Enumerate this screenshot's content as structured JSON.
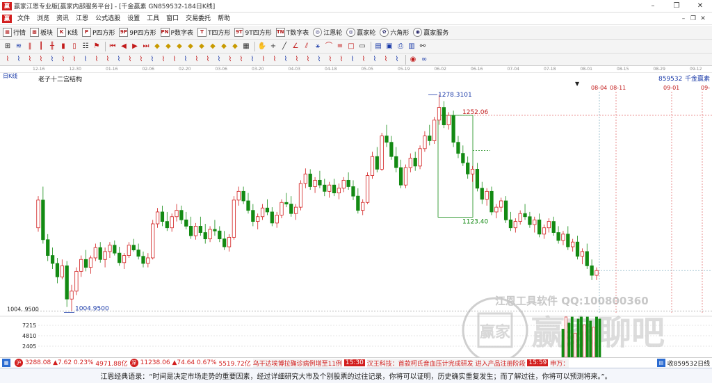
{
  "window": {
    "title": "赢家江恩专业版[赢家内部服务平台] - [千金赢素  GN859532-184日K线]",
    "logo_text": "赢",
    "minimize": "–",
    "maximize": "❐",
    "close": "✕"
  },
  "menu": {
    "items": [
      "文件",
      "浏览",
      "资讯",
      "江恩",
      "公式选股",
      "设置",
      "工具",
      "窗口",
      "交易委托",
      "帮助"
    ],
    "mdi_minimize": "–",
    "mdi_restore": "❐",
    "mdi_close": "✕"
  },
  "toolbar1": {
    "items": [
      {
        "icon": "▦",
        "label": "行情"
      },
      {
        "icon": "▩",
        "label": "板块"
      },
      {
        "icon": "K",
        "label": "K线"
      },
      {
        "icon": "P",
        "label": "P四方形"
      },
      {
        "icon": "9P",
        "label": "9P四方形"
      },
      {
        "icon": "PN",
        "label": "P数字表"
      },
      {
        "icon": "T",
        "label": "T四方形"
      },
      {
        "icon": "9T",
        "label": "9T四方形"
      },
      {
        "icon": "TN",
        "label": "T数字表"
      },
      {
        "icon": "◎",
        "label": "江恩轮"
      },
      {
        "icon": "◎",
        "label": "赢家轮"
      },
      {
        "icon": "✿",
        "label": "六角形"
      },
      {
        "icon": "◉",
        "label": "赢家服务"
      }
    ]
  },
  "chart_header": {
    "period": "日K线",
    "study_name": "老子十二宫结构",
    "code": "859532",
    "name": "千金赢素"
  },
  "datebar": {
    "labels": [
      "12-16",
      "12-30",
      "01-16",
      "02-06",
      "02-20",
      "03-06",
      "03-20",
      "04-03",
      "04-18",
      "05-05",
      "05-19",
      "06-02",
      "06-16",
      "07-04",
      "07-18",
      "08-01",
      "08-15",
      "08-29",
      "09-12"
    ]
  },
  "annotations": {
    "high": "1278.3101",
    "box_top": "1252.06",
    "box_bottom": "1123.40",
    "low": "1004.9500",
    "axis_low": "1004. 9500",
    "date_0804": "08-04",
    "date_0811": "08-11",
    "date_0901": "09-01",
    "date_09": "09-"
  },
  "volume_axis": {
    "ticks": [
      "7215",
      "4810",
      "2405"
    ]
  },
  "watermark": {
    "line1": "江恩工具软件  QQ:100800360",
    "brand": "赢家聊吧",
    "seal": "赢家"
  },
  "statusbar": {
    "index1_value": "3288.08",
    "index1_change": "▲7.62",
    "index1_pct": "0.23%",
    "index1_amount": "4971.88亿",
    "index2_value": "11238.06",
    "index2_change": "▲74.64",
    "index2_pct": "0.67%",
    "index2_amount": "5519.72亿",
    "news1": "乌干达埃博拉确诊病例增至11例",
    "news1_time": "15:30",
    "news2": "汉王科技：首款柯氏音血压计完成研发 进入产品注册阶段",
    "news2_time": "15:59",
    "news3": "申万：",
    "right_text": "收859532日线"
  },
  "quote": {
    "text": "江恩经典语录：“时间是决定市场走势的重要因素，经过详细研究大市及个别股票的过往记录，你将可以证明，历史确实重复发生；而了解过往，你将可以预测将来。”。"
  },
  "colors": {
    "up": "#d21e1e",
    "down": "#138a13",
    "accent_blue": "#1a3aa8"
  },
  "chart_data": {
    "type": "candlestick",
    "title": "老子十二宫结构",
    "ohlc": [
      [
        1110,
        1150,
        1105,
        1145
      ],
      [
        1145,
        1162,
        1090,
        1095
      ],
      [
        1095,
        1102,
        1068,
        1075
      ],
      [
        1075,
        1085,
        1058,
        1065
      ],
      [
        1065,
        1072,
        1040,
        1048
      ],
      [
        1048,
        1070,
        1045,
        1062
      ],
      [
        1062,
        1068,
        1010,
        1020
      ],
      [
        1020,
        1038,
        1005,
        1030
      ],
      [
        1030,
        1060,
        1025,
        1055
      ],
      [
        1055,
        1075,
        1048,
        1070
      ],
      [
        1070,
        1082,
        1055,
        1060
      ],
      [
        1060,
        1075,
        1052,
        1072
      ],
      [
        1072,
        1090,
        1068,
        1085
      ],
      [
        1085,
        1092,
        1066,
        1070
      ],
      [
        1070,
        1085,
        1060,
        1080
      ],
      [
        1080,
        1092,
        1072,
        1088
      ],
      [
        1088,
        1094,
        1075,
        1078
      ],
      [
        1078,
        1086,
        1062,
        1066
      ],
      [
        1066,
        1078,
        1058,
        1075
      ],
      [
        1075,
        1092,
        1072,
        1088
      ],
      [
        1088,
        1096,
        1080,
        1082
      ],
      [
        1082,
        1090,
        1070,
        1074
      ],
      [
        1074,
        1080,
        1060,
        1065
      ],
      [
        1065,
        1078,
        1060,
        1072
      ],
      [
        1072,
        1120,
        1070,
        1115
      ],
      [
        1115,
        1135,
        1110,
        1130
      ],
      [
        1130,
        1138,
        1112,
        1118
      ],
      [
        1118,
        1130,
        1106,
        1110
      ],
      [
        1110,
        1128,
        1105,
        1124
      ],
      [
        1124,
        1140,
        1118,
        1132
      ],
      [
        1132,
        1138,
        1115,
        1120
      ],
      [
        1120,
        1130,
        1108,
        1112
      ],
      [
        1112,
        1124,
        1096,
        1100
      ],
      [
        1100,
        1116,
        1095,
        1112
      ],
      [
        1112,
        1124,
        1100,
        1104
      ],
      [
        1104,
        1115,
        1090,
        1096
      ],
      [
        1096,
        1112,
        1092,
        1108
      ],
      [
        1108,
        1120,
        1100,
        1106
      ],
      [
        1106,
        1112,
        1092,
        1096
      ],
      [
        1096,
        1106,
        1082,
        1086
      ],
      [
        1086,
        1102,
        1080,
        1098
      ],
      [
        1098,
        1150,
        1095,
        1145
      ],
      [
        1145,
        1162,
        1138,
        1156
      ],
      [
        1156,
        1162,
        1140,
        1144
      ],
      [
        1144,
        1154,
        1128,
        1132
      ],
      [
        1132,
        1140,
        1112,
        1118
      ],
      [
        1118,
        1128,
        1108,
        1124
      ],
      [
        1124,
        1140,
        1120,
        1135
      ],
      [
        1135,
        1146,
        1126,
        1130
      ],
      [
        1130,
        1136,
        1112,
        1116
      ],
      [
        1116,
        1130,
        1110,
        1126
      ],
      [
        1126,
        1146,
        1122,
        1142
      ],
      [
        1142,
        1154,
        1136,
        1140
      ],
      [
        1140,
        1150,
        1124,
        1128
      ],
      [
        1128,
        1140,
        1120,
        1136
      ],
      [
        1136,
        1170,
        1132,
        1166
      ],
      [
        1166,
        1185,
        1160,
        1178
      ],
      [
        1178,
        1184,
        1158,
        1162
      ],
      [
        1162,
        1174,
        1154,
        1170
      ],
      [
        1170,
        1182,
        1160,
        1164
      ],
      [
        1164,
        1172,
        1150,
        1156
      ],
      [
        1156,
        1168,
        1148,
        1164
      ],
      [
        1164,
        1172,
        1150,
        1154
      ],
      [
        1154,
        1166,
        1146,
        1160
      ],
      [
        1160,
        1174,
        1155,
        1170
      ],
      [
        1170,
        1180,
        1158,
        1162
      ],
      [
        1162,
        1170,
        1145,
        1150
      ],
      [
        1150,
        1160,
        1128,
        1132
      ],
      [
        1132,
        1146,
        1126,
        1142
      ],
      [
        1142,
        1180,
        1140,
        1176
      ],
      [
        1176,
        1206,
        1172,
        1200
      ],
      [
        1200,
        1212,
        1180,
        1184
      ],
      [
        1184,
        1230,
        1182,
        1226
      ],
      [
        1226,
        1240,
        1212,
        1218
      ],
      [
        1218,
        1226,
        1196,
        1200
      ],
      [
        1200,
        1212,
        1180,
        1186
      ],
      [
        1186,
        1196,
        1160,
        1164
      ],
      [
        1164,
        1190,
        1160,
        1186
      ],
      [
        1186,
        1204,
        1180,
        1198
      ],
      [
        1198,
        1206,
        1182,
        1188
      ],
      [
        1188,
        1214,
        1184,
        1210
      ],
      [
        1210,
        1232,
        1206,
        1226
      ],
      [
        1226,
        1240,
        1214,
        1220
      ],
      [
        1220,
        1250,
        1216,
        1246
      ],
      [
        1246,
        1278,
        1240,
        1262
      ],
      [
        1262,
        1270,
        1236,
        1240
      ],
      [
        1240,
        1256,
        1234,
        1252
      ],
      [
        1252,
        1258,
        1212,
        1218
      ],
      [
        1218,
        1226,
        1198,
        1204
      ],
      [
        1204,
        1214,
        1188,
        1192
      ],
      [
        1192,
        1200,
        1172,
        1178
      ],
      [
        1178,
        1188,
        1168,
        1184
      ],
      [
        1184,
        1192,
        1156,
        1160
      ],
      [
        1160,
        1168,
        1140,
        1146
      ],
      [
        1146,
        1160,
        1138,
        1156
      ],
      [
        1156,
        1162,
        1126,
        1130
      ],
      [
        1130,
        1140,
        1122,
        1136
      ],
      [
        1136,
        1148,
        1130,
        1144
      ],
      [
        1144,
        1150,
        1116,
        1120
      ],
      [
        1120,
        1130,
        1106,
        1110
      ],
      [
        1110,
        1122,
        1104,
        1118
      ],
      [
        1118,
        1132,
        1114,
        1128
      ],
      [
        1128,
        1140,
        1120,
        1124
      ],
      [
        1124,
        1130,
        1110,
        1114
      ],
      [
        1114,
        1124,
        1104,
        1120
      ],
      [
        1120,
        1128,
        1098,
        1102
      ],
      [
        1102,
        1114,
        1096,
        1110
      ],
      [
        1110,
        1122,
        1104,
        1118
      ],
      [
        1118,
        1124,
        1100,
        1104
      ],
      [
        1104,
        1112,
        1090,
        1094
      ],
      [
        1094,
        1106,
        1088,
        1102
      ],
      [
        1102,
        1112,
        1082,
        1086
      ],
      [
        1086,
        1096,
        1080,
        1092
      ],
      [
        1092,
        1100,
        1070,
        1074
      ],
      [
        1074,
        1084,
        1064,
        1080
      ],
      [
        1080,
        1090,
        1058,
        1062
      ],
      [
        1062,
        1070,
        1044,
        1050
      ],
      [
        1050,
        1060,
        1044,
        1056
      ]
    ],
    "levels": {
      "high": 1278.3101,
      "box_top": 1252.06,
      "box_bottom": 1123.4,
      "low": 1004.95
    },
    "ylim": [
      1000,
      1295
    ]
  }
}
